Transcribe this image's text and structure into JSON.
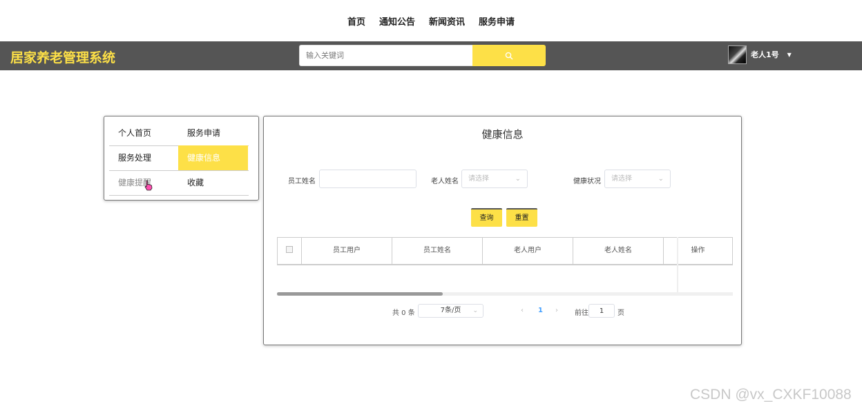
{
  "topnav": [
    "首页",
    "通知公告",
    "新闻资讯",
    "服务申请"
  ],
  "header": {
    "brand": "居家养老管理系统",
    "search_placeholder": "输入关键词",
    "user_name": "老人1号"
  },
  "sidebar": {
    "items": [
      "个人首页",
      "服务申请",
      "服务处理",
      "健康信息",
      "健康提醒",
      "收藏"
    ],
    "active": "健康信息"
  },
  "panel": {
    "title": "健康信息",
    "filters": {
      "staff_name_label": "员工姓名",
      "elder_name_label": "老人姓名",
      "elder_name_placeholder": "请选择",
      "health_status_label": "健康状况",
      "health_status_placeholder": "请选择"
    },
    "buttons": {
      "query": "查询",
      "reset": "重置"
    },
    "table": {
      "columns": [
        "员工用户",
        "员工姓名",
        "老人用户",
        "老人姓名",
        "操作"
      ],
      "rows": []
    },
    "pagination": {
      "total": "共 0 条",
      "page_size": "7条/页",
      "current_page": "1",
      "goto_label": "前往",
      "goto_value": "1",
      "page_unit": "页"
    }
  },
  "colors": {
    "accent": "#fde047",
    "header_bg": "#555555"
  },
  "watermark": "CSDN @vx_CXKF10088"
}
